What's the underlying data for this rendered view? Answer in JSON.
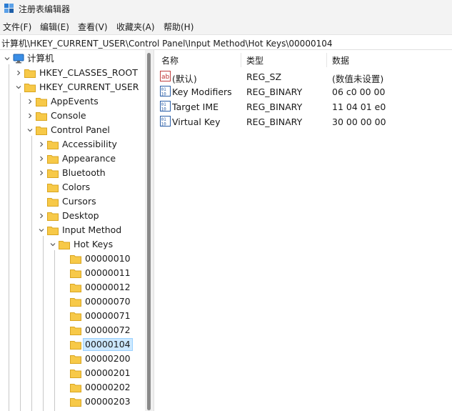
{
  "window": {
    "title": "注册表编辑器"
  },
  "menu": [
    "文件(F)",
    "编辑(E)",
    "查看(V)",
    "收藏夹(A)",
    "帮助(H)"
  ],
  "address": "计算机\\HKEY_CURRENT_USER\\Control Panel\\Input Method\\Hot Keys\\00000104",
  "tree": {
    "root": "计算机",
    "hkcr": "HKEY_CLASSES_ROOT",
    "hkcu": "HKEY_CURRENT_USER",
    "appevents": "AppEvents",
    "console": "Console",
    "control_panel": "Control Panel",
    "accessibility": "Accessibility",
    "appearance": "Appearance",
    "bluetooth": "Bluetooth",
    "colors": "Colors",
    "cursors": "Cursors",
    "desktop": "Desktop",
    "input_method": "Input Method",
    "hot_keys": "Hot Keys",
    "hotkey_items": [
      "00000010",
      "00000011",
      "00000012",
      "00000070",
      "00000071",
      "00000072",
      "00000104",
      "00000200",
      "00000201",
      "00000202",
      "00000203"
    ],
    "selected": "00000104"
  },
  "columns": {
    "name": "名称",
    "type": "类型",
    "data": "数据"
  },
  "values": [
    {
      "name": "(默认)",
      "type": "REG_SZ",
      "data": "(数值未设置)",
      "icon": "string-value-icon"
    },
    {
      "name": "Key Modifiers",
      "type": "REG_BINARY",
      "data": "06 c0 00 00",
      "icon": "binary-value-icon"
    },
    {
      "name": "Target IME",
      "type": "REG_BINARY",
      "data": "11 04 01 e0",
      "icon": "binary-value-icon"
    },
    {
      "name": "Virtual Key",
      "type": "REG_BINARY",
      "data": "30 00 00 00",
      "icon": "binary-value-icon"
    }
  ],
  "colors": {
    "folder": "#f7c948",
    "selection": "#cce8ff",
    "accent": "#0078d4"
  }
}
